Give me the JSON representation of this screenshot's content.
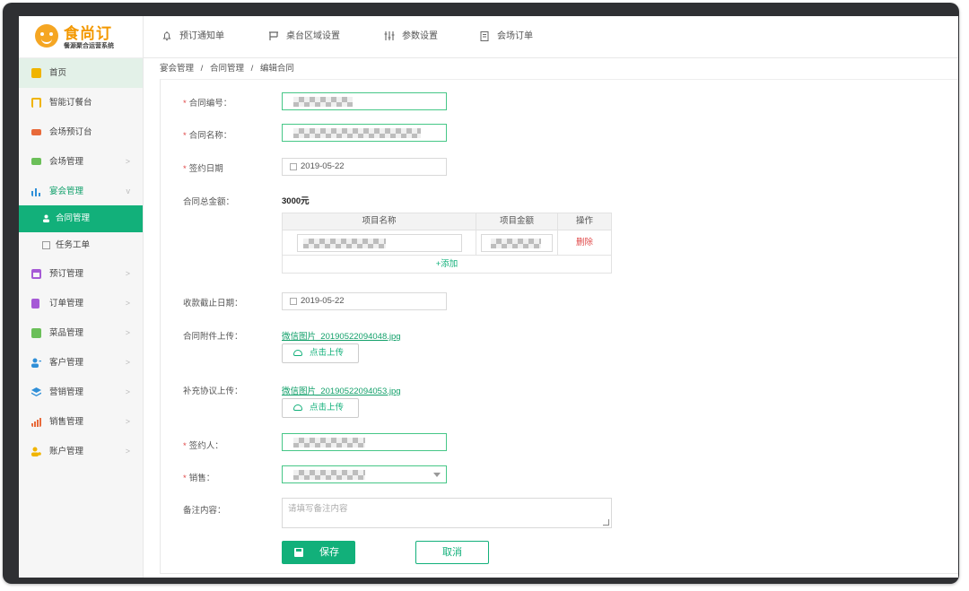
{
  "brand": {
    "title": "食尚订",
    "subtitle": "餐源聚合运营系统"
  },
  "colors": {
    "accent": "#12b07a",
    "brand": "#f39800",
    "required": "#e04848"
  },
  "topnav": [
    {
      "label": "预订通知单",
      "icon": "bell-icon"
    },
    {
      "label": "桌台区域设置",
      "icon": "table-icon"
    },
    {
      "label": "参数设置",
      "icon": "sliders-icon"
    },
    {
      "label": "会场订单",
      "icon": "clipboard-icon"
    }
  ],
  "sidebar": {
    "items": [
      {
        "label": "首页",
        "icon": "home-icon",
        "color": "#f0b400"
      },
      {
        "label": "智能订餐台",
        "icon": "booking-icon",
        "color": "#f0b400"
      },
      {
        "label": "会场预订台",
        "icon": "venue-icon",
        "color": "#e86a3a"
      },
      {
        "label": "会场管理",
        "icon": "venue-manage-icon",
        "color": "#6bbf59"
      },
      {
        "label": "宴会管理",
        "icon": "banquet-icon",
        "color": "#2f8fd8"
      },
      {
        "label": "合同管理",
        "icon": "user-icon"
      },
      {
        "label": "任务工单",
        "icon": "task-icon"
      },
      {
        "label": "预订管理",
        "icon": "calendar-icon",
        "color": "#a65ad6"
      },
      {
        "label": "订单管理",
        "icon": "order-icon",
        "color": "#a65ad6"
      },
      {
        "label": "菜品管理",
        "icon": "dish-icon",
        "color": "#6bbf59"
      },
      {
        "label": "客户管理",
        "icon": "customer-icon",
        "color": "#2f8fd8"
      },
      {
        "label": "营销管理",
        "icon": "marketing-icon",
        "color": "#2f8fd8"
      },
      {
        "label": "销售管理",
        "icon": "sales-icon",
        "color": "#e86a3a"
      },
      {
        "label": "账户管理",
        "icon": "account-icon",
        "color": "#f0b400"
      }
    ]
  },
  "breadcrumb": {
    "l1": "宴会管理",
    "sep": "/",
    "l2": "合同管理",
    "l3": "编辑合同"
  },
  "form": {
    "contract_no_label": "合同编号：",
    "contract_name_label": "合同名称：",
    "sign_date_label": "签约日期",
    "sign_date": "2019-05-22",
    "total_label": "合同总金额：",
    "total": "3000元",
    "table": {
      "headers": [
        "项目名称",
        "项目金额",
        "操作"
      ],
      "delete_label": "删除",
      "add_label": "+添加"
    },
    "pay_deadline_label": "收款截止日期：",
    "pay_deadline": "2019-05-22",
    "attach_label": "合同附件上传：",
    "attach_file": "微信图片_20190522094048.jpg",
    "upload_label": "点击上传",
    "supplement_label": "补充协议上传：",
    "supplement_file": "微信图片_20190522094053.jpg",
    "signer_label": "签约人：",
    "sales_label": "销售：",
    "remark_label": "备注内容：",
    "remark_placeholder": "请填写备注内容",
    "save_label": "保存",
    "cancel_label": "取消"
  }
}
